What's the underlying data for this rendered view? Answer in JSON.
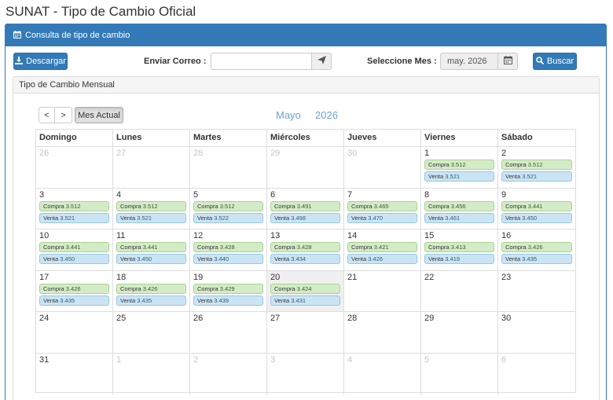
{
  "page": {
    "title": "SUNAT - Tipo de Cambio Oficial"
  },
  "panel": {
    "heading": "Consulta de tipo de cambio"
  },
  "toolbar": {
    "download_label": "Descargar",
    "email_label": "Enviar Correo :",
    "email_value": "",
    "month_label": "Seleccione Mes :",
    "month_value": "may. 2026",
    "search_label": "Buscar"
  },
  "monthly": {
    "heading": "Tipo de Cambio Mensual"
  },
  "calendar": {
    "prev_label": "<",
    "next_label": ">",
    "current_label": "Mes Actual",
    "month_name": "Mayo",
    "year": "2026",
    "weekdays": [
      "Domingo",
      "Lunes",
      "Martes",
      "Miércoles",
      "Jueves",
      "Viernes",
      "Sábado"
    ],
    "compra_label": "Compra",
    "venta_label": "Venta",
    "weeks": [
      [
        {
          "day": "26",
          "other": true
        },
        {
          "day": "27",
          "other": true
        },
        {
          "day": "28",
          "other": true
        },
        {
          "day": "29",
          "other": true
        },
        {
          "day": "30",
          "other": true
        },
        {
          "day": "1",
          "compra": "3.512",
          "venta": "3.521"
        },
        {
          "day": "2",
          "compra": "3.512",
          "venta": "3.521"
        }
      ],
      [
        {
          "day": "3",
          "compra": "3.512",
          "venta": "3.521"
        },
        {
          "day": "4",
          "compra": "3.512",
          "venta": "3.521"
        },
        {
          "day": "5",
          "compra": "3.512",
          "venta": "3.522"
        },
        {
          "day": "6",
          "compra": "3.491",
          "venta": "3.498"
        },
        {
          "day": "7",
          "compra": "3.465",
          "venta": "3.470"
        },
        {
          "day": "8",
          "compra": "3.456",
          "venta": "3.461"
        },
        {
          "day": "9",
          "compra": "3.441",
          "venta": "3.450"
        }
      ],
      [
        {
          "day": "10",
          "compra": "3.441",
          "venta": "3.450"
        },
        {
          "day": "11",
          "compra": "3.441",
          "venta": "3.450"
        },
        {
          "day": "12",
          "compra": "3.428",
          "venta": "3.440"
        },
        {
          "day": "13",
          "compra": "3.428",
          "venta": "3.434"
        },
        {
          "day": "14",
          "compra": "3.421",
          "venta": "3.426"
        },
        {
          "day": "15",
          "compra": "3.413",
          "venta": "3.419"
        },
        {
          "day": "16",
          "compra": "3.426",
          "venta": "3.435"
        }
      ],
      [
        {
          "day": "17",
          "compra": "3.426",
          "venta": "3.435"
        },
        {
          "day": "18",
          "compra": "3.426",
          "venta": "3.435"
        },
        {
          "day": "19",
          "compra": "3.429",
          "venta": "3.439"
        },
        {
          "day": "20",
          "compra": "3.424",
          "venta": "3.431",
          "today": true
        },
        {
          "day": "21"
        },
        {
          "day": "22"
        },
        {
          "day": "23"
        }
      ],
      [
        {
          "day": "24"
        },
        {
          "day": "25"
        },
        {
          "day": "26"
        },
        {
          "day": "27"
        },
        {
          "day": "28"
        },
        {
          "day": "29"
        },
        {
          "day": "30"
        }
      ],
      [
        {
          "day": "31"
        },
        {
          "day": "1",
          "other": true
        },
        {
          "day": "2",
          "other": true
        },
        {
          "day": "3",
          "other": true
        },
        {
          "day": "4",
          "other": true
        },
        {
          "day": "5",
          "other": true
        },
        {
          "day": "6",
          "other": true
        }
      ]
    ]
  },
  "colors": {
    "primary": "#337ab7",
    "compra_bg": "#d4ebc8",
    "venta_bg": "#cbe4f4",
    "title_blue": "#6f9fcf"
  }
}
